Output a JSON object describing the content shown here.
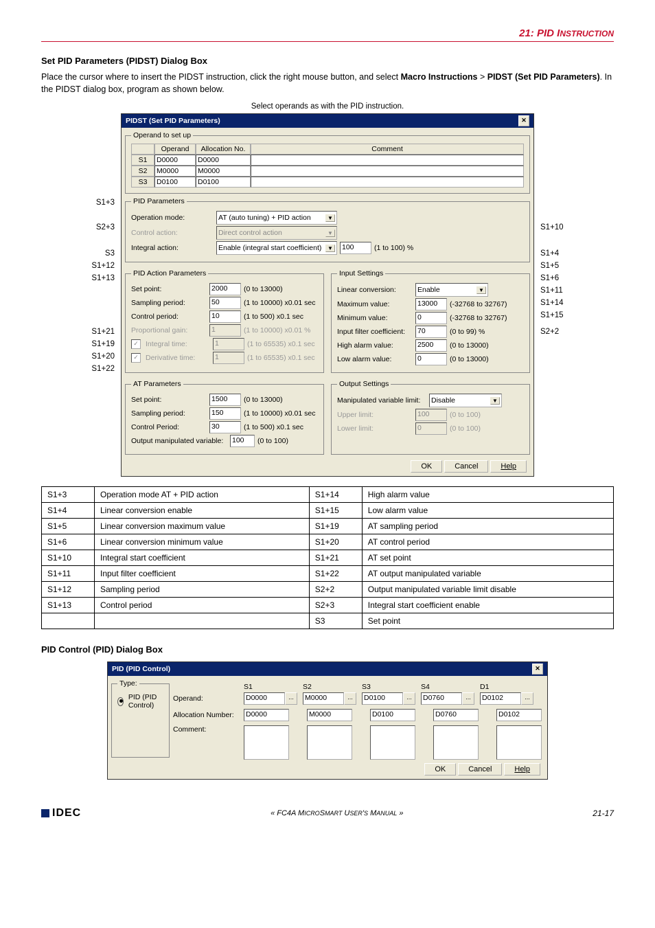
{
  "page_header": {
    "section_num": "21:",
    "section_title_a": "PID I",
    "section_title_b": "NSTRUCTION"
  },
  "h1": "Set PID Parameters (PIDST) Dialog Box",
  "intro_a": "Place the cursor where to insert the PIDST instruction, click the right mouse button, and select ",
  "intro_b": "Macro Instructions",
  "intro_c": " > ",
  "intro_d": "PIDST (Set PID Parameters)",
  "intro_e": ". In the PIDST dialog box, program as shown below.",
  "caption1": "Select operands as with the PID instruction.",
  "dlg1": {
    "title": "PIDST (Set PID Parameters)",
    "grp_operand": "Operand to set up",
    "tbl": {
      "h1": "Operand",
      "h2": "Allocation No.",
      "h3": "Comment",
      "r1c1": "S1",
      "r1c2": "D0000",
      "r1c3": "D0000",
      "r2c1": "S2",
      "r2c2": "M0000",
      "r2c3": "M0000",
      "r3c1": "S3",
      "r3c2": "D0100",
      "r3c3": "D0100"
    },
    "grp_pid": "PID Parameters",
    "op_mode_lab": "Operation mode:",
    "op_mode_val": "AT (auto tuning) + PID action",
    "ctrl_act_lab": "Control action:",
    "ctrl_act_val": "Direct control action",
    "int_act_lab": "Integral action:",
    "int_act_val": "Enable (integral start coefficient)",
    "int_act_num": "100",
    "int_act_rng": "(1 to 100) %",
    "grp_pidact": "PID Action Parameters",
    "set_point_lab": "Set point:",
    "set_point_val": "2000",
    "set_point_rng": "(0 to 13000)",
    "samp_lab": "Sampling period:",
    "samp_val": "50",
    "samp_rng": "(1 to 10000) x0.01 sec",
    "cper_lab": "Control period:",
    "cper_val": "10",
    "cper_rng": "(1 to 500) x0.1 sec",
    "pgain_lab": "Proportional gain:",
    "pgain_val": "1",
    "pgain_rng": "(1 to 10000) x0.01 %",
    "itime_lab": "Integral time:",
    "itime_val": "1",
    "itime_rng": "(1 to 65535) x0.1 sec",
    "dtime_lab": "Derivative time:",
    "dtime_val": "1",
    "dtime_rng": "(1 to 65535) x0.1 sec",
    "grp_input": "Input Settings",
    "linconv_lab": "Linear conversion:",
    "linconv_val": "Enable",
    "max_lab": "Maximum value:",
    "max_val": "13000",
    "max_rng": "(-32768 to 32767)",
    "min_lab": "Minimum value:",
    "min_val": "0",
    "min_rng": "(-32768 to 32767)",
    "filt_lab": "Input filter coefficient:",
    "filt_val": "70",
    "filt_rng": "(0 to 99) %",
    "hal_lab": "High alarm value:",
    "hal_val": "2500",
    "hal_rng": "(0 to 13000)",
    "lal_lab": "Low alarm value:",
    "lal_val": "0",
    "lal_rng": "(0 to 13000)",
    "grp_at": "AT Parameters",
    "at_sp_lab": "Set point:",
    "at_sp_val": "1500",
    "at_sp_rng": "(0 to 13000)",
    "at_samp_lab": "Sampling period:",
    "at_samp_val": "150",
    "at_samp_rng": "(1 to 10000) x0.01 sec",
    "at_cp_lab": "Control Period:",
    "at_cp_val": "30",
    "at_cp_rng": "(1 to 500) x0.1 sec",
    "at_omv_lab": "Output manipulated variable:",
    "at_omv_val": "100",
    "at_omv_rng": "(0 to 100)",
    "grp_out": "Output Settings",
    "mvl_lab": "Manipulated variable limit:",
    "mvl_val": "Disable",
    "ul_lab": "Upper limit:",
    "ul_val": "100",
    "ul_rng": "(0 to 100)",
    "ll_lab": "Lower limit:",
    "ll_val": "0",
    "ll_rng": "(0 to 100)",
    "btn_ok": "OK",
    "btn_cancel": "Cancel",
    "btn_help": "Help"
  },
  "left_labels": {
    "l1": "S1+3",
    "l2": "S2+3",
    "l3": "S3",
    "l4": "S1+12",
    "l5": "S1+13",
    "l6": "S1+21",
    "l7": "S1+19",
    "l8": "S1+20",
    "l9": "S1+22"
  },
  "right_labels": {
    "r1": "S1+10",
    "r2": "S1+4",
    "r3": "S1+5",
    "r4": "S1+6",
    "r5": "S1+11",
    "r6": "S1+14",
    "r7": "S1+15",
    "r8": "S2+2"
  },
  "map": [
    [
      "S1+3",
      "Operation mode AT + PID action",
      "S1+14",
      "High alarm value"
    ],
    [
      "S1+4",
      "Linear conversion enable",
      "S1+15",
      "Low alarm value"
    ],
    [
      "S1+5",
      "Linear conversion maximum value",
      "S1+19",
      "AT sampling period"
    ],
    [
      "S1+6",
      "Linear conversion minimum value",
      "S1+20",
      "AT control period"
    ],
    [
      "S1+10",
      "Integral start coefficient",
      "S1+21",
      "AT set point"
    ],
    [
      "S1+11",
      "Input filter coefficient",
      "S1+22",
      "AT output manipulated variable"
    ],
    [
      "S1+12",
      "Sampling period",
      "S2+2",
      "Output manipulated variable limit disable"
    ],
    [
      "S1+13",
      "Control period",
      "S2+3",
      "Integral start coefficient enable"
    ],
    [
      "",
      "",
      "S3",
      "Set point"
    ]
  ],
  "h2b": "PID Control (PID) Dialog Box",
  "dlg2": {
    "title": "PID (PID Control)",
    "grp_type": "Type:",
    "type_radio": "PID (PID Control)",
    "operand_lab": "Operand:",
    "alloc_lab": "Allocation Number:",
    "comment_lab": "Comment:",
    "cols": [
      "S1",
      "S2",
      "S3",
      "S4",
      "D1"
    ],
    "op_vals": [
      "D0000",
      "M0000",
      "D0100",
      "D0760",
      "D0102"
    ],
    "an_vals": [
      "D0000",
      "M0000",
      "D0100",
      "D0760",
      "D0102"
    ],
    "btn_ok": "OK",
    "btn_cancel": "Cancel",
    "btn_help": "Help"
  },
  "footer": {
    "brand": "IDEC",
    "mid_a": "« FC4A M",
    "mid_b": "ICRO",
    "mid_c": "S",
    "mid_d": "MART",
    "mid_e": " U",
    "mid_f": "SER",
    "mid_g": "'",
    "mid_h": "S",
    "mid_i": " M",
    "mid_j": "ANUAL",
    "mid_k": " »",
    "page": "21-17"
  }
}
